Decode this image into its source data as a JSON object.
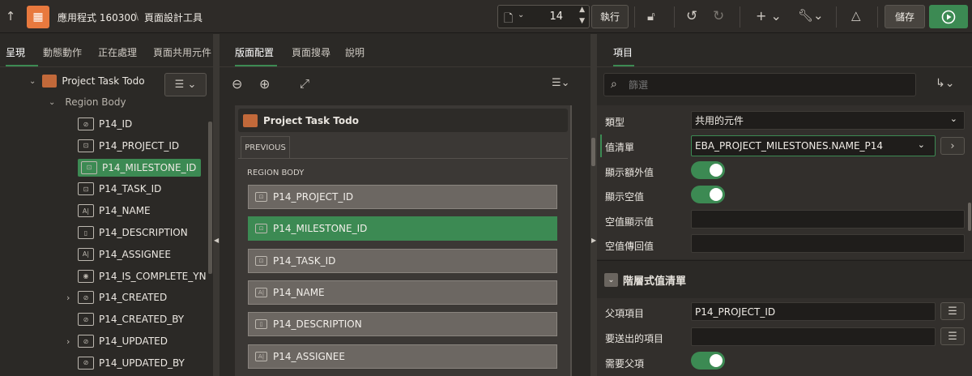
{
  "header": {
    "app_name": "應用程式 160300",
    "separator": "\\",
    "page_tool": "頁面設計工具",
    "page_number": "14",
    "run_label": "執行",
    "save_label": "儲存"
  },
  "left": {
    "tabs": [
      "呈現",
      "動態動作",
      "正在處理",
      "頁面共用元件"
    ],
    "region_title": "Project Task Todo",
    "region_body": "Region Body",
    "items": [
      {
        "label": "P14_ID",
        "icon": "hidden-item-icon",
        "expand": false
      },
      {
        "label": "P14_PROJECT_ID",
        "icon": "popup-lov-icon",
        "expand": false
      },
      {
        "label": "P14_MILESTONE_ID",
        "icon": "popup-lov-icon",
        "expand": false,
        "selected": true
      },
      {
        "label": "P14_TASK_ID",
        "icon": "popup-lov-icon",
        "expand": false
      },
      {
        "label": "P14_NAME",
        "icon": "text-field-icon",
        "expand": false
      },
      {
        "label": "P14_DESCRIPTION",
        "icon": "textarea-icon",
        "expand": false
      },
      {
        "label": "P14_ASSIGNEE",
        "icon": "text-field-icon",
        "expand": false
      },
      {
        "label": "P14_IS_COMPLETE_YN",
        "icon": "switch-icon",
        "expand": false
      },
      {
        "label": "P14_CREATED",
        "icon": "hidden-item-icon",
        "expand": true
      },
      {
        "label": "P14_CREATED_BY",
        "icon": "hidden-item-icon",
        "expand": false
      },
      {
        "label": "P14_UPDATED",
        "icon": "hidden-item-icon",
        "expand": true
      },
      {
        "label": "P14_UPDATED_BY",
        "icon": "hidden-item-icon",
        "expand": false
      }
    ]
  },
  "center": {
    "tabs": [
      "版面配置",
      "頁面搜尋",
      "說明"
    ],
    "region_title": "Project Task Todo",
    "previous_label": "PREVIOUS",
    "region_body_label": "REGION BODY",
    "items": [
      {
        "label": "P14_PROJECT_ID",
        "icon": "popup-lov-icon"
      },
      {
        "label": "P14_MILESTONE_ID",
        "icon": "popup-lov-icon",
        "selected": true
      },
      {
        "label": "P14_TASK_ID",
        "icon": "popup-lov-icon"
      },
      {
        "label": "P14_NAME",
        "icon": "text-field-icon"
      },
      {
        "label": "P14_DESCRIPTION",
        "icon": "textarea-icon"
      },
      {
        "label": "P14_ASSIGNEE",
        "icon": "text-field-icon"
      }
    ]
  },
  "right": {
    "tab": "項目",
    "filter_placeholder": "篩選",
    "props": {
      "type_label": "類型",
      "type_value": "共用的元件",
      "lov_label": "值清單",
      "lov_value": "EBA_PROJECT_MILESTONES.NAME_P14",
      "extra_label": "顯示額外值",
      "null_label": "顯示空值",
      "null_display_label": "空值顯示值",
      "null_return_label": "空值傳回值",
      "cascade_section": "階層式值清單",
      "parent_label": "父項項目",
      "parent_value": "P14_PROJECT_ID",
      "submit_label": "要送出的項目",
      "require_parent_label": "需要父項"
    }
  }
}
